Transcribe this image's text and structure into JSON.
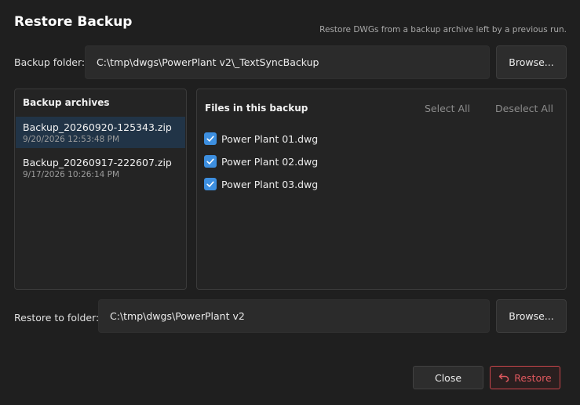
{
  "dialog": {
    "title": "Restore Backup",
    "subtitle": "Restore DWGs from a backup archive left by a previous run."
  },
  "backup_folder": {
    "label": "Backup folder:",
    "value": "C:\\tmp\\dwgs\\PowerPlant v2\\_TextSyncBackup",
    "browse_label": "Browse..."
  },
  "archives": {
    "header": "Backup archives",
    "items": [
      {
        "name": "Backup_20260920-125343.zip",
        "date": "9/20/2026 12:53:48 PM",
        "selected": true
      },
      {
        "name": "Backup_20260917-222607.zip",
        "date": "9/17/2026 10:26:14 PM",
        "selected": false
      }
    ]
  },
  "files": {
    "header": "Files in this backup",
    "select_all_label": "Select All",
    "deselect_all_label": "Deselect All",
    "items": [
      {
        "name": "Power Plant 01.dwg",
        "checked": true
      },
      {
        "name": "Power Plant 02.dwg",
        "checked": true
      },
      {
        "name": "Power Plant 03.dwg",
        "checked": true
      }
    ]
  },
  "restore_folder": {
    "label": "Restore to folder:",
    "value": "C:\\tmp\\dwgs\\PowerPlant v2",
    "browse_label": "Browse..."
  },
  "footer": {
    "close_label": "Close",
    "restore_label": "Restore"
  },
  "colors": {
    "accent": "#3d8fe0",
    "selection": "#213447",
    "danger": "#e0585e",
    "background": "#1f1f1f"
  },
  "icons": {
    "restore": "undo-arrow-icon",
    "checkbox": "checkmark-icon"
  }
}
